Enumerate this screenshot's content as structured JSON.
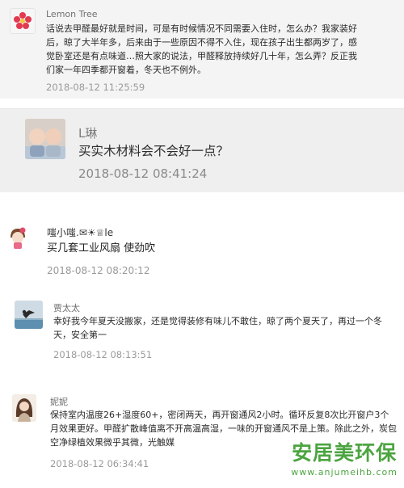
{
  "comments": [
    {
      "author": "Lemon Tree",
      "text": "话说去甲醛最好就是时间，可是有时候情况不同需要入住时，怎么办？我家装好后，晾了大半年多，后来由于一些原因不得不入住，现在孩子出生都两岁了，感觉卧室还是有点味道…照大家的说法，甲醛释放持续好几十年，怎么弄？反正我们家一年四季都开窗着，冬天也不例外。",
      "time": "2018-08-12 11:25:59",
      "avatar_icon": "flower-avatar-icon"
    },
    {
      "author": "L琳",
      "text": "买实木材料会不会好一点？",
      "time": "2018-08-12 08:41:24",
      "avatar_icon": "twin-babies-photo-avatar"
    },
    {
      "author": "嗤小嗤.✉☀♕le",
      "text": "买几套工业风扇 使劲吹",
      "time": "2018-08-12 08:20:12",
      "avatar_icon": "cartoon-girl-avatar"
    },
    {
      "author": "贾太太",
      "text": "幸好我今年夏天没搬家，还是觉得装修有味儿不敢住，晾了两个夏天了，再过一个冬天，安全第一",
      "time": "2018-08-12 08:13:51",
      "avatar_icon": "seaside-silhouette-avatar"
    },
    {
      "author": "妮妮",
      "text": "保持室内温度26+湿度60+，密闭两天，再开窗通风2小时。循环反复8次比开窗户3个月效果更好。甲醛扩散峰值离不开高温高湿，一味的开窗通风不是上策。除此之外，炭包空净绿植效果微乎其微，光触媒",
      "time": "2018-08-12 06:34:41",
      "avatar_icon": "girl-portrait-avatar"
    }
  ],
  "watermark": {
    "title": "安居美环保",
    "url": "www.anjumeihb.com"
  },
  "colors": {
    "card_highlight": "#f4f4f4",
    "timestamp": "#9a9a9a",
    "watermark": "#3f9e32"
  }
}
